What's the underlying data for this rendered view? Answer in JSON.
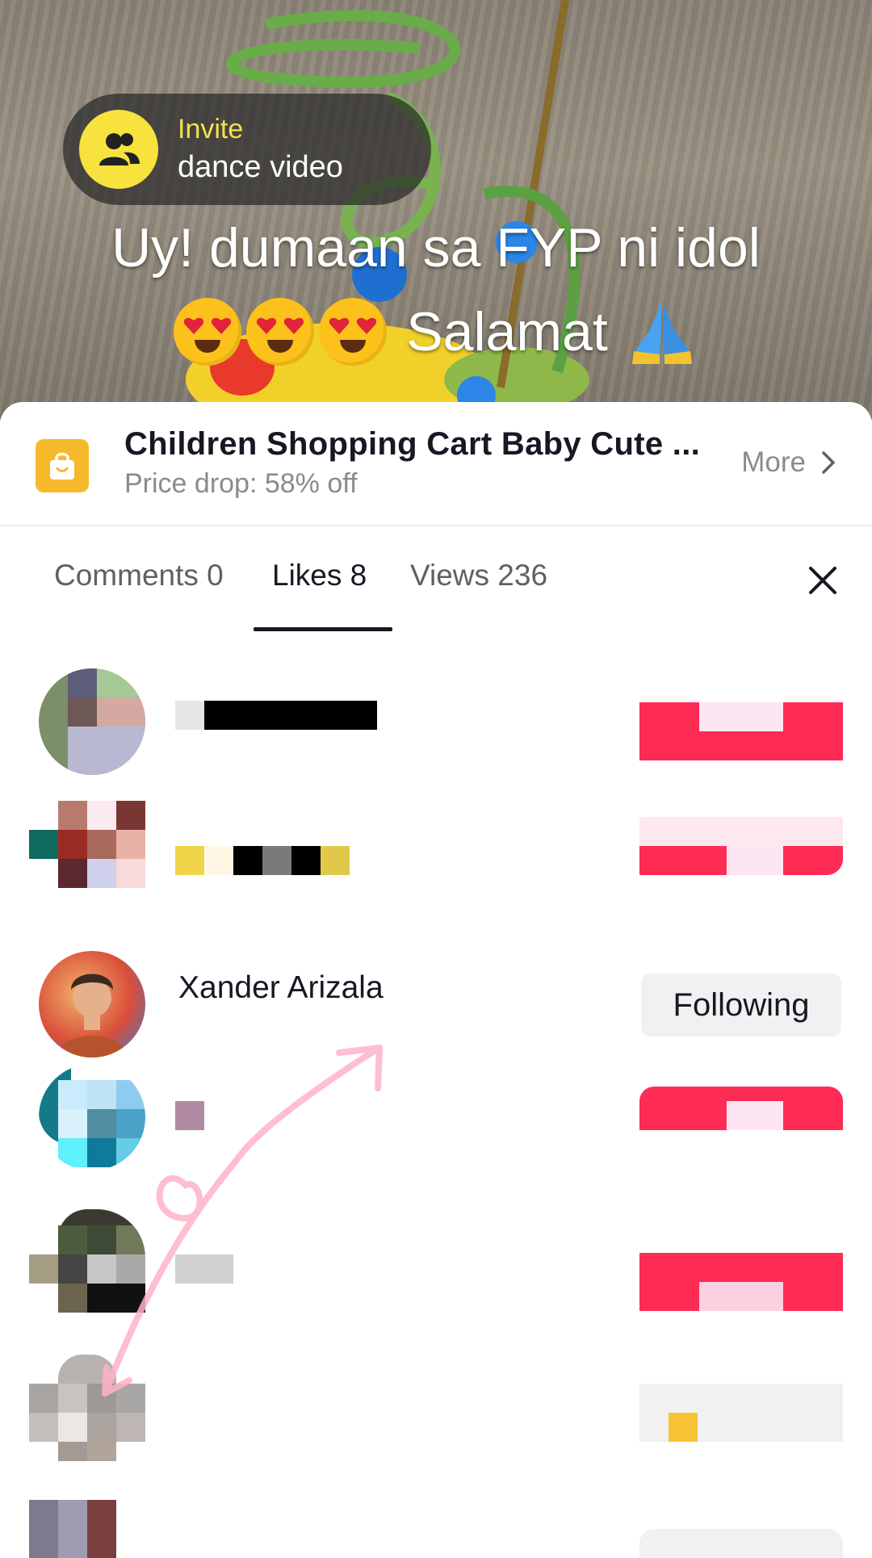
{
  "video": {
    "invite": {
      "top": "Invite",
      "bottom": "dance video",
      "icon": "people-icon"
    },
    "caption_line1": "Uy! dumaan sa FYP ni idol",
    "caption_line2": "Salamat"
  },
  "product": {
    "icon": "shopping-bag-icon",
    "title": "Children Shopping Cart Baby Cute ...",
    "subtitle": "Price drop: 58% off",
    "more_label": "More"
  },
  "tabs": [
    {
      "label": "Comments 0",
      "active": false
    },
    {
      "label": "Likes 8",
      "active": true
    },
    {
      "label": "Views 236",
      "active": false
    }
  ],
  "likes": [
    {
      "name": "",
      "button": ""
    },
    {
      "name": "",
      "button": ""
    },
    {
      "name": "Xander Arizala",
      "button": "Following"
    },
    {
      "name": "",
      "button": ""
    },
    {
      "name": "",
      "button": ""
    },
    {
      "name": "",
      "button": ""
    }
  ],
  "colors": {
    "accent": "#fe2c55",
    "tab_text": "#161823",
    "muted": "#8a8b91",
    "bag": "#f7b92c",
    "invite_yellow": "#f7e23e"
  }
}
